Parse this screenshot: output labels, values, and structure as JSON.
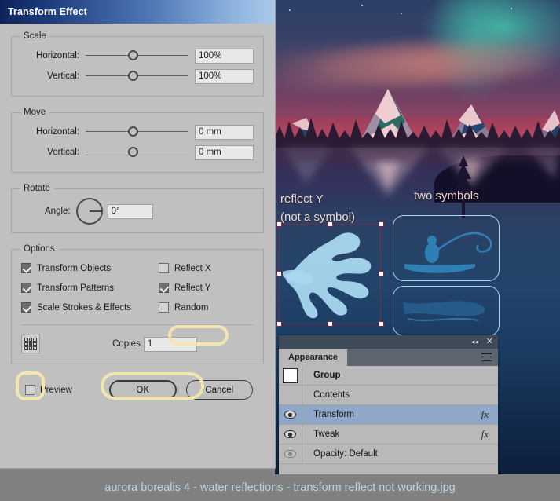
{
  "dialog": {
    "title": "Transform Effect",
    "groups": {
      "scale": {
        "legend": "Scale",
        "rows": [
          {
            "label": "Horizontal:",
            "mnemonic": "o",
            "value": "100%"
          },
          {
            "label": "Vertical:",
            "mnemonic": "V",
            "value": "100%"
          }
        ]
      },
      "move": {
        "legend": "Move",
        "rows": [
          {
            "label": "Horizontal:",
            "mnemonic": "o",
            "value": "0 mm"
          },
          {
            "label": "Vertical:",
            "mnemonic": "e",
            "value": "0 mm"
          }
        ]
      },
      "rotate": {
        "legend": "Rotate",
        "angle_label": "Angle:",
        "angle_value": "0°"
      },
      "options": {
        "legend": "Options",
        "left_checkboxes": [
          {
            "label": "Transform Objects",
            "checked": true
          },
          {
            "label": "Transform Patterns",
            "checked": true
          },
          {
            "label": "Scale Strokes & Effects",
            "checked": true
          }
        ],
        "right_checkboxes": [
          {
            "label": "Reflect X",
            "checked": false
          },
          {
            "label": "Reflect Y",
            "checked": true
          },
          {
            "label": "Random",
            "checked": false
          }
        ],
        "copies_label": "Copies",
        "copies_value": "1",
        "reference_point_icon": "nine-point-grid-icon"
      }
    },
    "footer": {
      "preview_label": "Preview",
      "preview_checked": false,
      "ok_label": "OK",
      "cancel_label": "Cancel"
    },
    "highlight_color": "#f2e6ae"
  },
  "canvas": {
    "annotations": [
      {
        "line1": "reflect Y",
        "line2": "(not a symbol)"
      },
      {
        "line1": "two symbols"
      }
    ],
    "annotation_color": "#f0d9d2",
    "selection_handle_color": "#ffffff",
    "selection_border_color": "#7b2a45",
    "symbol_outline_color": "#a9d4ef"
  },
  "appearance_panel": {
    "tab_label": "Appearance",
    "collapse_icon": "collapse-double-chevron-icon",
    "close_icon": "close-icon",
    "menu_icon": "panel-menu-icon",
    "rows": [
      {
        "label": "Group",
        "bold": true,
        "has_eye": false,
        "has_swatch": true,
        "fx": "",
        "selected": false,
        "dotted": false
      },
      {
        "label": "Contents",
        "bold": false,
        "has_eye": false,
        "has_swatch": false,
        "fx": "",
        "selected": false,
        "dotted": false
      },
      {
        "label": "Transform",
        "bold": false,
        "has_eye": true,
        "has_swatch": false,
        "fx": "fx",
        "selected": true,
        "dotted": true
      },
      {
        "label": "Tweak",
        "bold": false,
        "has_eye": true,
        "has_swatch": false,
        "fx": "fx",
        "selected": false,
        "dotted": true
      },
      {
        "label": "Opacity:  Default",
        "bold": false,
        "has_eye": true,
        "eye_dim": true,
        "has_swatch": false,
        "fx": "",
        "selected": false,
        "dotted": true
      }
    ]
  },
  "caption": {
    "text": "aurora borealis 4 - water reflections - transform reflect not working.jpg",
    "color": "#bcd6e4"
  }
}
